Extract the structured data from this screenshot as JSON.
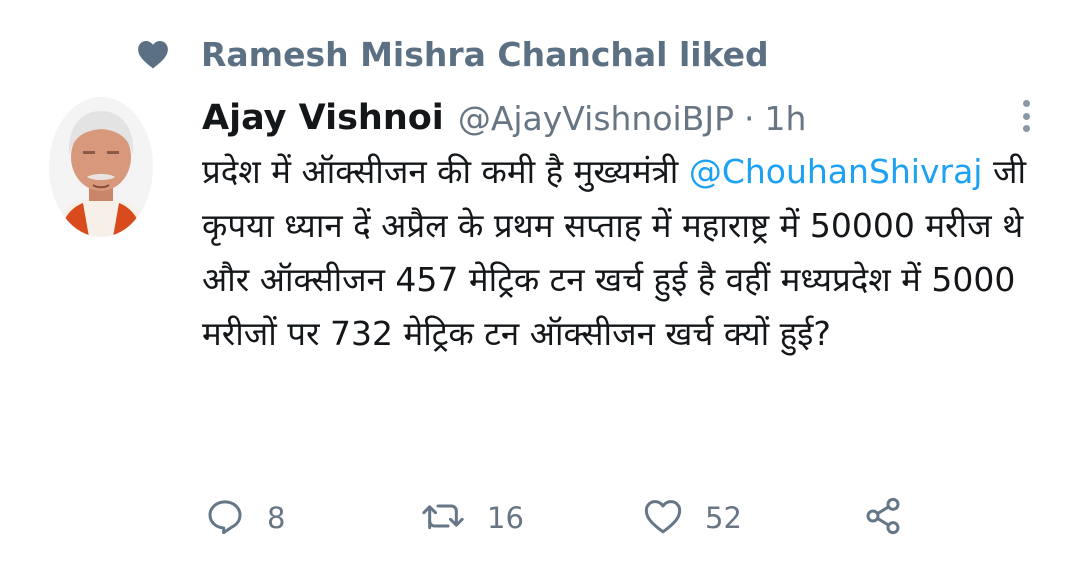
{
  "social_context": {
    "icon": "heart-icon",
    "text": "Ramesh Mishra Chanchal liked"
  },
  "tweet": {
    "author_name": "Ajay Vishnoi",
    "author_handle": "@AjayVishnoiBJP",
    "separator": "·",
    "timestamp": "1h",
    "body_before": "प्रदेश में ऑक्सीजन की कमी है मुख्यमंत्री ",
    "mention": "@ChouhanShivraj",
    "body_after": " जी कृपया ध्यान दें अप्रैल के प्रथम सप्ताह में महाराष्ट्र में 50000 मरीज थे और ऑक्सीजन 457 मेट्रिक टन खर्च हुई है वहीं मध्यप्रदेश में 5000 मरीजों पर 732 मेट्रिक टन ऑक्सीजन खर्च क्यों हुई?"
  },
  "actions": {
    "reply_count": "8",
    "retweet_count": "16",
    "like_count": "52"
  },
  "colors": {
    "secondary_text": "#5b7083",
    "link": "#1da1f2",
    "primary_text": "#14171a"
  }
}
